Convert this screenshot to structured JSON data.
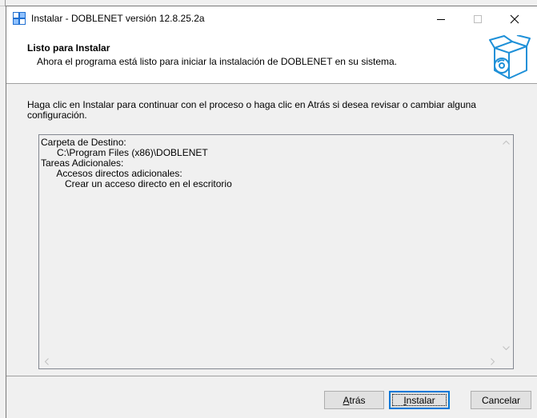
{
  "window": {
    "title": "Instalar - DOBLENET versión 12.8.25.2a",
    "controls": {
      "minimize": "—",
      "maximize": "☐",
      "close": "✕"
    }
  },
  "header": {
    "title": "Listo para Instalar",
    "subtitle": "Ahora el programa está listo para iniciar la instalación de DOBLENET en su sistema."
  },
  "instructions": "Haga clic en Instalar para continuar con el proceso o haga clic en Atrás si desea revisar o cambiar alguna configuración.",
  "memo": {
    "lines": [
      "Carpeta de Destino:",
      "      C:\\Program Files (x86)\\DOBLENET",
      "",
      "Tareas Adicionales:",
      "      Accesos directos adicionales:",
      "         Crear un acceso directo en el escritorio"
    ]
  },
  "buttons": {
    "back": {
      "accel": "A",
      "rest": "trás"
    },
    "install": {
      "accel": "I",
      "rest": "nstalar"
    },
    "cancel": "Cancelar"
  },
  "colors": {
    "accent": "#0078d7",
    "background": "#f0f0f0",
    "header_bg": "#ffffff"
  }
}
